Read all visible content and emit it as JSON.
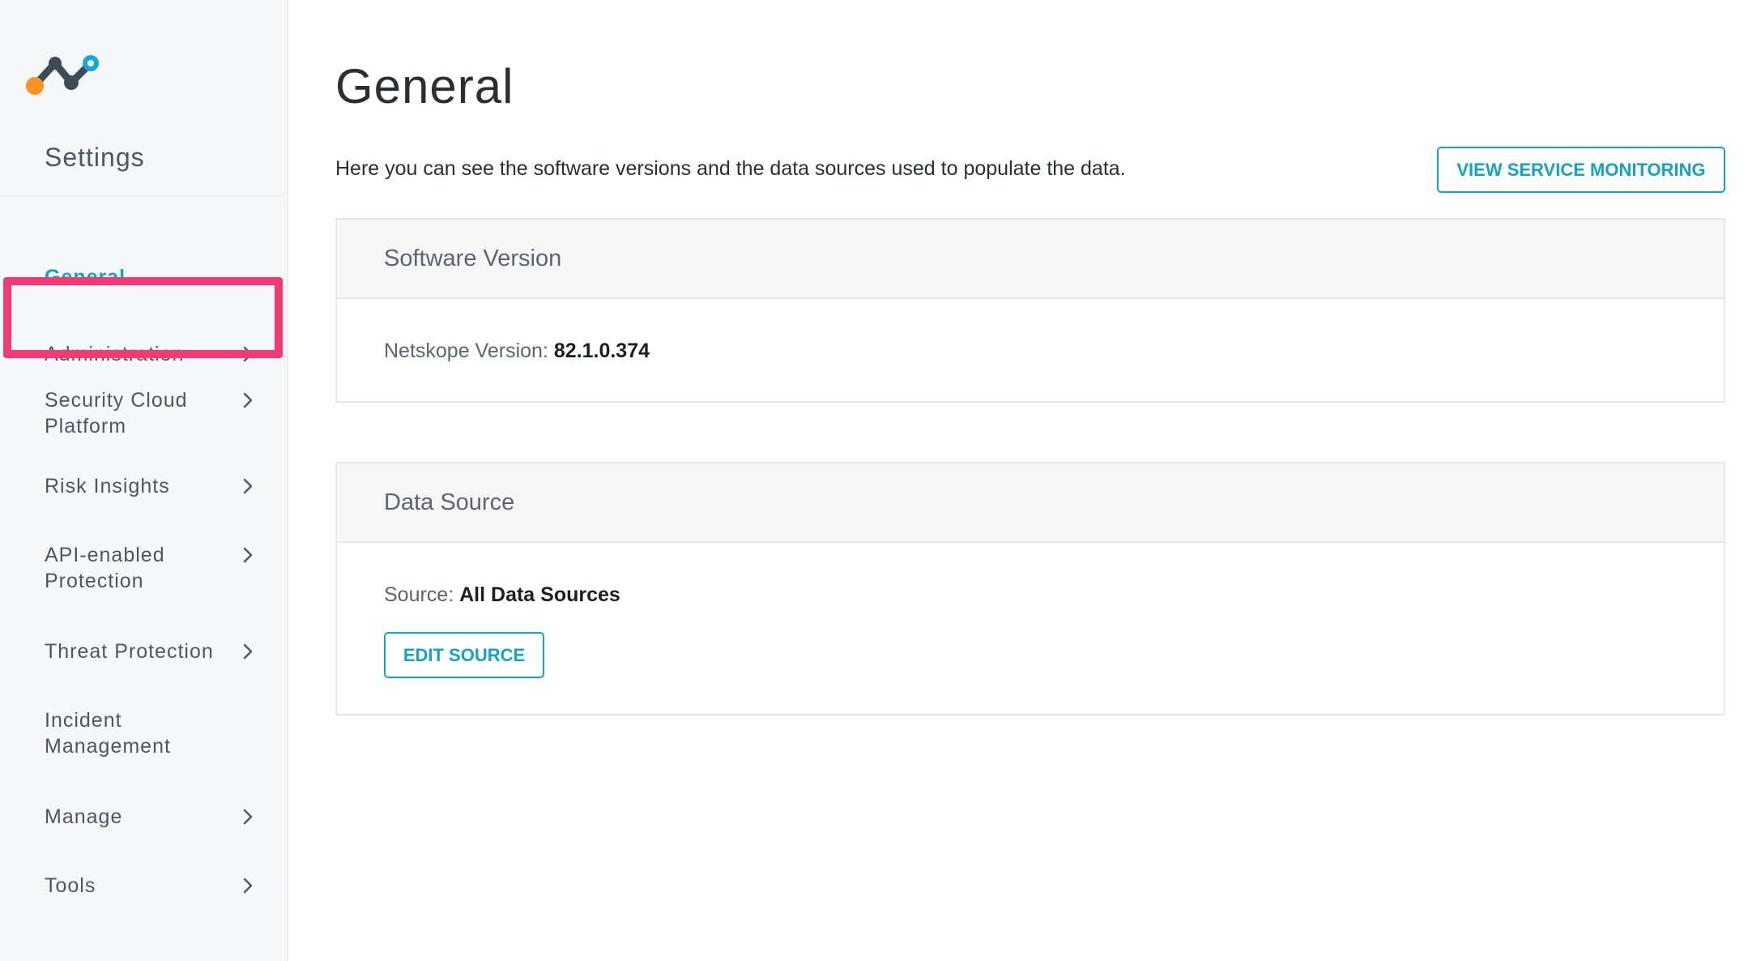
{
  "sidebar": {
    "title": "Settings",
    "items": [
      {
        "label": "General",
        "has_chevron": false,
        "active": true
      },
      {
        "label": "Administration",
        "has_chevron": true,
        "active": false
      },
      {
        "label": "Security Cloud Platform",
        "has_chevron": true,
        "active": false
      },
      {
        "label": "Risk Insights",
        "has_chevron": true,
        "active": false
      },
      {
        "label": "API-enabled Protection",
        "has_chevron": true,
        "active": false
      },
      {
        "label": "Threat Protection",
        "has_chevron": true,
        "active": false
      },
      {
        "label": "Incident Management",
        "has_chevron": false,
        "active": false
      },
      {
        "label": "Manage",
        "has_chevron": true,
        "active": false
      },
      {
        "label": "Tools",
        "has_chevron": true,
        "active": false
      }
    ],
    "highlighted_item": "Administration"
  },
  "main": {
    "title": "General",
    "description": "Here you can see the software versions and the data sources used to populate the data.",
    "view_service_monitoring_label": "VIEW SERVICE MONITORING",
    "software_version": {
      "header": "Software Version",
      "key": "Netskope Version:",
      "value": "82.1.0.374"
    },
    "data_source": {
      "header": "Data Source",
      "key": "Source:",
      "value": "All Data Sources",
      "edit_label": "EDIT SOURCE"
    }
  },
  "colors": {
    "accent": "#13a3c5",
    "highlight": "#f23b74",
    "sidebar_bg": "#f6f7f8",
    "logo_orange": "#f7931e",
    "logo_dark": "#3d4a57",
    "logo_blue": "#16a8d8"
  },
  "icons": {
    "logo": "netskope-logo",
    "chevron": "chevron-right-icon"
  }
}
